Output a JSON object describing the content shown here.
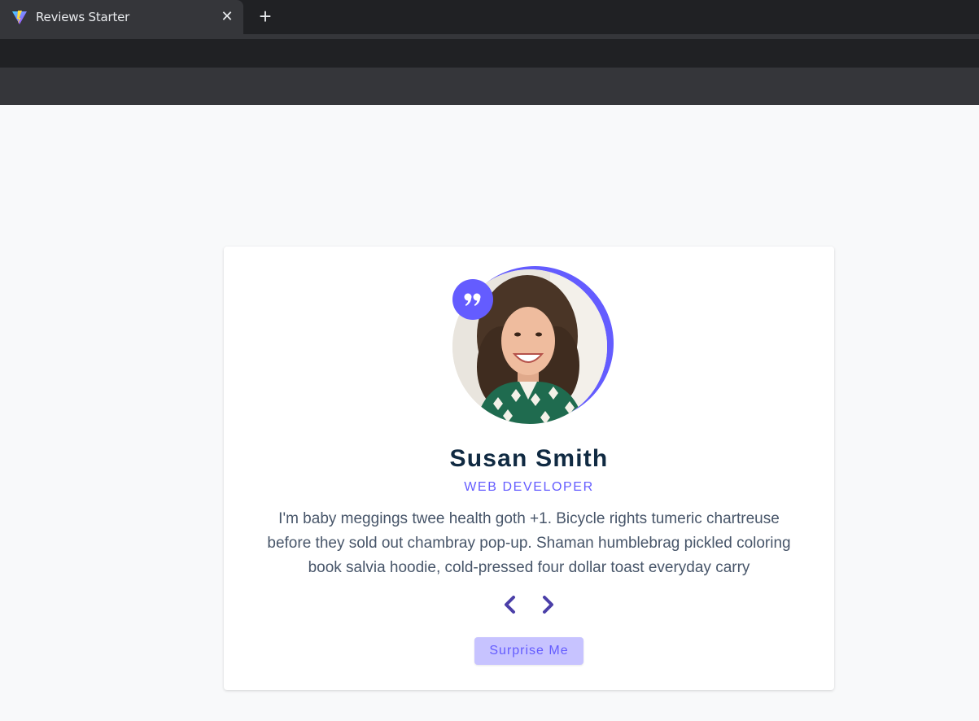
{
  "browser": {
    "tab_title": "Reviews Starter",
    "close_icon": "close-icon",
    "new_tab_icon": "plus-icon"
  },
  "review": {
    "name": "Susan Smith",
    "job": "web developer",
    "text": "I'm baby meggings twee health goth +1. Bicycle rights tumeric chartreuse before they sold out chambray pop-up. Shaman humblebrag pickled coloring book salvia hoodie, cold-pressed four dollar toast everyday carry",
    "quote_icon": "quote-icon",
    "prev_icon": "chevron-left-icon",
    "next_icon": "chevron-right-icon",
    "random_label": "Surprise Me"
  },
  "colors": {
    "accent": "#645cff",
    "accent_light": "#c7c3ff",
    "heading": "#102a42",
    "body_text": "#475569",
    "nav_arrow": "#4b3fa8"
  }
}
